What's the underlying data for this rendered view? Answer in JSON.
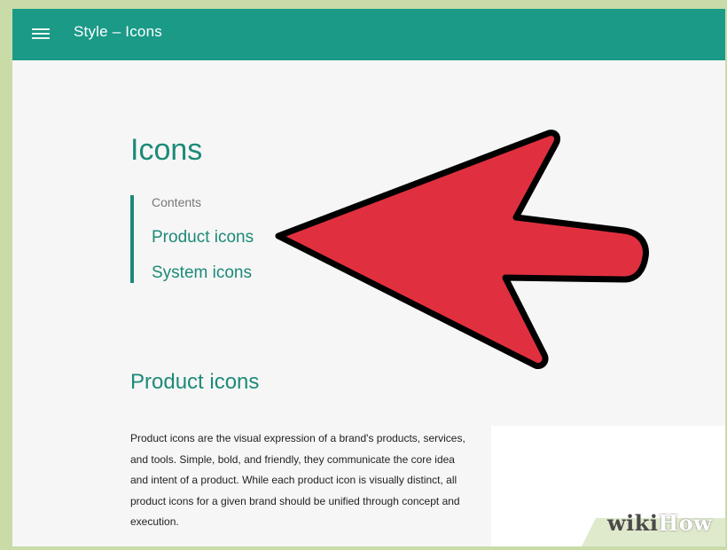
{
  "appbar": {
    "menu_icon": "hamburger-menu-icon",
    "title": "Style  –  Icons",
    "background": "#1a9a87"
  },
  "page": {
    "title": "Icons"
  },
  "contents": {
    "heading": "Contents",
    "links": [
      {
        "label": "Product icons"
      },
      {
        "label": "System icons"
      }
    ]
  },
  "section": {
    "title": "Product icons",
    "body": "Product icons are the visual expression of a brand's products, services, and tools. Simple, bold, and friendly, they communicate the core idea and intent of a product. While each product icon is visually distinct, all product icons for a given brand should be unified through concept and execution."
  },
  "overlay": {
    "arrow_icon": "red-arrow-pointer",
    "arrow_color": "#e0303f",
    "watermark": {
      "part1": "wiki",
      "part2": "How"
    }
  },
  "colors": {
    "accent": "#1c8a78",
    "page_bg": "#f6f6f6",
    "border": "#c9dca8"
  }
}
